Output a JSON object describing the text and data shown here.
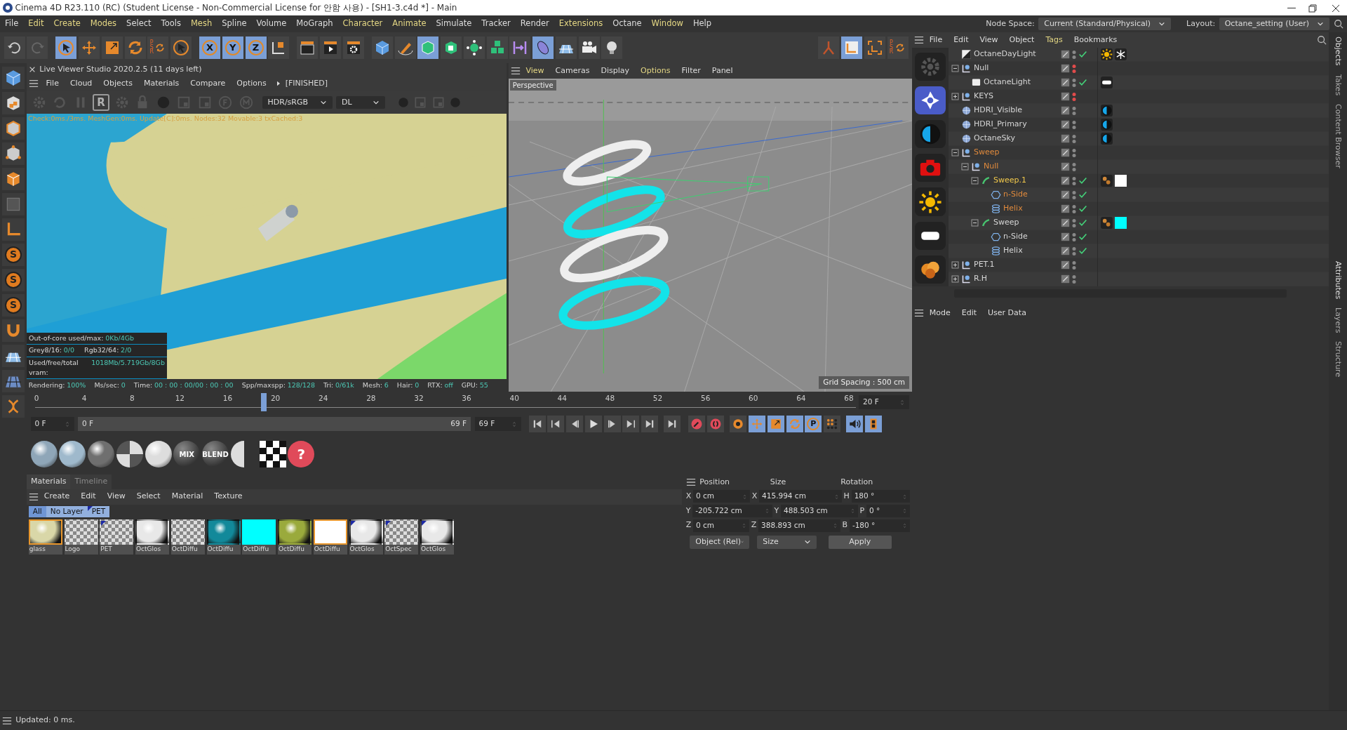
{
  "window": {
    "title": "Cinema 4D R23.110 (RC) (Student License - Non-Commercial License for 안함 사용) - [SH1-3.c4d *] - Main"
  },
  "menu_bar": [
    {
      "label": "File",
      "accent": false
    },
    {
      "label": "Edit",
      "accent": true
    },
    {
      "label": "Create",
      "accent": true
    },
    {
      "label": "Modes",
      "accent": true
    },
    {
      "label": "Select",
      "accent": false
    },
    {
      "label": "Tools",
      "accent": false
    },
    {
      "label": "Mesh",
      "accent": true
    },
    {
      "label": "Spline",
      "accent": false
    },
    {
      "label": "Volume",
      "accent": false
    },
    {
      "label": "MoGraph",
      "accent": false
    },
    {
      "label": "Character",
      "accent": true
    },
    {
      "label": "Animate",
      "accent": true
    },
    {
      "label": "Simulate",
      "accent": false
    },
    {
      "label": "Tracker",
      "accent": false
    },
    {
      "label": "Render",
      "accent": false
    },
    {
      "label": "Extensions",
      "accent": true
    },
    {
      "label": "Octane",
      "accent": false
    },
    {
      "label": "Window",
      "accent": true
    },
    {
      "label": "Help",
      "accent": false
    }
  ],
  "node_space": {
    "label": "Node Space:",
    "value": "Current (Standard/Physical)"
  },
  "layout": {
    "label": "Layout:",
    "value": "Octane_setting (User)"
  },
  "main_toolbar": [
    {
      "kind": "undo",
      "selected": false
    },
    {
      "kind": "redo",
      "selected": false
    },
    {
      "kind": "cursor",
      "selected": true
    },
    {
      "kind": "move",
      "selected": false
    },
    {
      "kind": "scale",
      "selected": false
    },
    {
      "kind": "rotate",
      "selected": false
    },
    {
      "kind": "psr",
      "label": "PSR",
      "selected": false
    },
    {
      "kind": "cursor",
      "selected": false
    },
    {
      "kind": "axis",
      "label": "X",
      "selected": true
    },
    {
      "kind": "axis",
      "label": "Y",
      "selected": true
    },
    {
      "kind": "axis",
      "label": "Z",
      "selected": true
    },
    {
      "kind": "coord",
      "selected": false
    },
    {
      "kind": "clapper",
      "selected": false
    },
    {
      "kind": "clapper-play",
      "selected": false
    },
    {
      "kind": "clapper-gear",
      "selected": false
    },
    {
      "kind": "cube",
      "selected": false
    },
    {
      "kind": "pen",
      "selected": false
    },
    {
      "kind": "cube-outline",
      "selected": true
    },
    {
      "kind": "cube-frame",
      "selected": false
    },
    {
      "kind": "node-sphere",
      "selected": false
    },
    {
      "kind": "cubes",
      "selected": false
    },
    {
      "kind": "bracket",
      "selected": false
    },
    {
      "kind": "disc",
      "selected": true
    },
    {
      "kind": "floor",
      "selected": false
    },
    {
      "kind": "camera",
      "selected": false
    },
    {
      "kind": "bulb",
      "selected": false
    }
  ],
  "snap_toolbar": [
    {
      "kind": "joint",
      "selected": false
    },
    {
      "kind": "frame",
      "selected": true
    },
    {
      "kind": "corner",
      "selected": false
    },
    {
      "kind": "psr",
      "label": "PSR",
      "selected": false
    }
  ],
  "left_tools": [
    {
      "kind": "cube"
    },
    {
      "kind": "checker-cube"
    },
    {
      "kind": "edge-cube"
    },
    {
      "kind": "point-cube"
    },
    {
      "kind": "solid-cube"
    },
    {
      "kind": "dark-cube"
    },
    {
      "kind": "l-angle"
    },
    {
      "kind": "s-circle",
      "label": "S"
    },
    {
      "kind": "s-circle",
      "label": "S"
    },
    {
      "kind": "s-circle",
      "label": "S"
    },
    {
      "kind": "magnet"
    },
    {
      "kind": "floor"
    },
    {
      "kind": "plane-grid"
    },
    {
      "kind": "twist"
    }
  ],
  "live_viewer": {
    "title": "Live Viewer Studio 2020.2.5 (11 days left)",
    "menu": [
      "File",
      "Cloud",
      "Objects",
      "Materials",
      "Compare",
      "Options"
    ],
    "status": "[FINISHED]",
    "toolbar": [
      {
        "kind": "gear"
      },
      {
        "kind": "refresh"
      },
      {
        "kind": "pause"
      },
      {
        "kind": "letter",
        "label": "R"
      },
      {
        "kind": "gear"
      },
      {
        "kind": "lock"
      },
      {
        "kind": "ball"
      },
      {
        "kind": "region"
      },
      {
        "kind": "region"
      },
      {
        "kind": "f-circle"
      },
      {
        "kind": "m-circle"
      }
    ],
    "color_mode": "HDR/sRGB",
    "kernel": "DL",
    "info": "Check:0ms./3ms. MeshGen:0ms. Update[C]:0ms. Nodes:32 Movable:3 txCached:3",
    "overlay_rows": [
      [
        {
          "label": "Out-of-core used/max:",
          "value": "0Kb/4Gb"
        }
      ],
      [
        {
          "label": "Grey8/16:",
          "value": "0/0"
        },
        {
          "label": "Rgb32/64:",
          "value": "2/0"
        }
      ],
      [
        {
          "label": "Used/free/total vram:",
          "value": "1018Mb/5.719Gb/8Gb"
        }
      ]
    ],
    "stats": [
      {
        "label": "Rendering:",
        "value": "100%"
      },
      {
        "label": "Ms/sec:",
        "value": "0"
      },
      {
        "label": "Time:",
        "value": "00 : 00 : 00/00 : 00 : 00"
      },
      {
        "label": "Spp/maxspp:",
        "value": "128/128"
      },
      {
        "label": "Tri:",
        "value": "0/61k"
      },
      {
        "label": "Mesh:",
        "value": "6"
      },
      {
        "label": "Hair:",
        "value": "0"
      },
      {
        "label": "RTX:",
        "value": "off"
      },
      {
        "label": "GPU:",
        "value": "55"
      }
    ]
  },
  "viewport": {
    "menu": [
      {
        "label": "View",
        "accent": true
      },
      {
        "label": "Cameras",
        "accent": false
      },
      {
        "label": "Display",
        "accent": false
      },
      {
        "label": "Options",
        "accent": true
      },
      {
        "label": "Filter",
        "accent": false
      },
      {
        "label": "Panel",
        "accent": false
      }
    ],
    "camera": "Perspective",
    "grid_spacing": "Grid Spacing : 500 cm"
  },
  "octane_tools": [
    {
      "kind": "gear",
      "selected": false
    },
    {
      "kind": "aperture",
      "selected": true
    },
    {
      "kind": "half-circle",
      "selected": false
    },
    {
      "kind": "camera-red",
      "selected": false
    },
    {
      "kind": "sun",
      "selected": false
    },
    {
      "kind": "light-rect",
      "selected": false
    },
    {
      "kind": "explosion",
      "selected": false
    }
  ],
  "object_manager": {
    "menu": [
      {
        "label": "File",
        "accent": false
      },
      {
        "label": "Edit",
        "accent": false
      },
      {
        "label": "View",
        "accent": false
      },
      {
        "label": "Object",
        "accent": false
      },
      {
        "label": "Tags",
        "accent": true
      },
      {
        "label": "Bookmarks",
        "accent": false
      }
    ],
    "objects": [
      {
        "name": "OctaneDayLight",
        "kind": "daylight",
        "selected": false,
        "active": false,
        "visibility_off": false,
        "enabled": true,
        "tags": [
          {
            "kind": "sun"
          },
          {
            "kind": "snowflake"
          }
        ]
      },
      {
        "name": "Null",
        "kind": "null",
        "selected": false,
        "active": false,
        "visibility_off": true,
        "enabled": false,
        "expanded": true,
        "children": [
          {
            "name": "OctaneLight",
            "kind": "light",
            "selected": false,
            "active": false,
            "visibility_off": false,
            "enabled": true,
            "tags": [
              {
                "kind": "light-rect"
              }
            ]
          }
        ]
      },
      {
        "name": "KEYS",
        "kind": "null",
        "selected": false,
        "active": false,
        "visibility_off": true,
        "enabled": false,
        "expanded": false
      },
      {
        "name": "HDRI_Visible",
        "kind": "sky",
        "selected": false,
        "active": false,
        "visibility_off": false,
        "enabled": false,
        "tags": [
          {
            "kind": "half-circle"
          }
        ]
      },
      {
        "name": "HDRI_Primary",
        "kind": "sky",
        "selected": false,
        "active": false,
        "visibility_off": false,
        "enabled": false,
        "tags": [
          {
            "kind": "half-circle"
          }
        ]
      },
      {
        "name": "OctaneSky",
        "kind": "sky",
        "selected": false,
        "active": false,
        "visibility_off": false,
        "enabled": false,
        "tags": [
          {
            "kind": "half-circle"
          }
        ]
      },
      {
        "name": "Sweep",
        "kind": "null",
        "selected": true,
        "active": false,
        "visibility_off": false,
        "enabled": false,
        "expanded": true,
        "children": [
          {
            "name": "Null",
            "kind": "null",
            "selected": true,
            "active": false,
            "visibility_off": false,
            "enabled": false,
            "expanded": true,
            "children": [
              {
                "name": "Sweep.1",
                "kind": "sweep",
                "selected": true,
                "active": true,
                "visibility_off": false,
                "enabled": true,
                "expanded": true,
                "tags": [
                  {
                    "kind": "phong"
                  },
                  {
                    "kind": "material",
                    "color": "#ffffff"
                  }
                ],
                "children": [
                  {
                    "name": "n-Side",
                    "kind": "nside",
                    "selected": true,
                    "active": false,
                    "visibility_off": false,
                    "enabled": true
                  },
                  {
                    "name": "Helix",
                    "kind": "helix",
                    "selected": true,
                    "active": false,
                    "visibility_off": false,
                    "enabled": true
                  }
                ]
              },
              {
                "name": "Sweep",
                "kind": "sweep",
                "selected": false,
                "active": false,
                "visibility_off": false,
                "enabled": true,
                "expanded": true,
                "tags": [
                  {
                    "kind": "phong"
                  },
                  {
                    "kind": "material",
                    "color": "#00ffff"
                  }
                ],
                "children": [
                  {
                    "name": "n-Side",
                    "kind": "nside",
                    "selected": false,
                    "active": false,
                    "visibility_off": false,
                    "enabled": true
                  },
                  {
                    "name": "Helix",
                    "kind": "helix",
                    "selected": false,
                    "active": false,
                    "visibility_off": false,
                    "enabled": true
                  }
                ]
              }
            ]
          }
        ]
      },
      {
        "name": "PET.1",
        "kind": "null",
        "selected": false,
        "active": false,
        "visibility_off": false,
        "enabled": false,
        "expanded": false
      },
      {
        "name": "R.H",
        "kind": "null",
        "selected": false,
        "active": false,
        "visibility_off": false,
        "enabled": false,
        "expanded": false
      }
    ]
  },
  "side_tabs_top": [
    "Objects",
    "Takes",
    "Content Browser"
  ],
  "attributes": {
    "menu": [
      "Mode",
      "Edit",
      "User Data"
    ]
  },
  "side_tabs_bottom": [
    "Attributes",
    "Layers",
    "Structure"
  ],
  "timeline": {
    "ticks": [
      "0",
      "4",
      "8",
      "12",
      "16",
      "20",
      "24",
      "28",
      "32",
      "36",
      "40",
      "44",
      "48",
      "52",
      "56",
      "60",
      "64",
      "68"
    ],
    "level": 0.28,
    "current_frame": "20 F",
    "start": "0 F",
    "range_start": "0 F",
    "range_end": "69 F",
    "end": "69 F",
    "transport": [
      {
        "kind": "first"
      },
      {
        "kind": "prev-key"
      },
      {
        "kind": "prev-frame"
      },
      {
        "kind": "play"
      },
      {
        "kind": "next-frame"
      },
      {
        "kind": "next-key"
      },
      {
        "kind": "last-frame"
      },
      {
        "kind": "goto-end"
      }
    ],
    "keys": [
      {
        "kind": "record"
      },
      {
        "kind": "autokey"
      },
      {
        "kind": "key-gear"
      },
      {
        "kind": "move"
      },
      {
        "kind": "scale"
      },
      {
        "kind": "rotate"
      },
      {
        "kind": "letter",
        "label": "P"
      },
      {
        "kind": "dots"
      },
      {
        "kind": "speaker"
      },
      {
        "kind": "film"
      }
    ]
  },
  "material_presets": [
    {
      "kind": "sphere",
      "color": "#8fa6b8"
    },
    {
      "kind": "sphere",
      "color": "#9fb9cc"
    },
    {
      "kind": "sphere",
      "color": "#6f6f6f"
    },
    {
      "kind": "quad"
    },
    {
      "kind": "sphere",
      "color": "#dddddd"
    },
    {
      "kind": "label",
      "label": "MIX"
    },
    {
      "kind": "label",
      "label": "BLEND"
    },
    {
      "kind": "split"
    },
    {
      "kind": "checker"
    },
    {
      "kind": "help",
      "label": "?"
    }
  ],
  "materials": {
    "tabs": [
      {
        "label": "Materials",
        "selected": true
      },
      {
        "label": "Timeline",
        "selected": false
      }
    ],
    "menu": [
      "Create",
      "Edit",
      "View",
      "Select",
      "Material",
      "Texture"
    ],
    "layers": [
      {
        "label": "All",
        "selected": true,
        "flag": false
      },
      {
        "label": "No Layer",
        "selected": false,
        "flag": false
      },
      {
        "label": "PET",
        "selected": false,
        "flag": true
      }
    ],
    "items": [
      {
        "name": "glass",
        "kind": "sphere",
        "color": "#d9d7a8",
        "selected": true,
        "flag": false
      },
      {
        "name": "Logo",
        "kind": "checker",
        "selected": false,
        "flag": false
      },
      {
        "name": "PET",
        "kind": "checker",
        "selected": false,
        "flag": true
      },
      {
        "name": "OctGlos",
        "kind": "sphere",
        "color": "#e8e8e8",
        "selected": false,
        "flag": false
      },
      {
        "name": "OctDiffu",
        "kind": "checker",
        "selected": false,
        "flag": false
      },
      {
        "name": "OctDiffu",
        "kind": "sphere",
        "color": "#12899a",
        "selected": false,
        "flag": false
      },
      {
        "name": "OctDiffu",
        "kind": "flat",
        "color": "#00ffff",
        "selected": false,
        "flag": false
      },
      {
        "name": "OctDiffu",
        "kind": "sphere",
        "color": "#9aaa3c",
        "selected": false,
        "flag": false
      },
      {
        "name": "OctDiffu",
        "kind": "flat",
        "color": "#ffffff",
        "selected": true,
        "flag": false
      },
      {
        "name": "OctGlos",
        "kind": "sphere",
        "color": "#e8e8e8",
        "selected": false,
        "flag": true
      },
      {
        "name": "OctSpec",
        "kind": "checker",
        "selected": false,
        "flag": true
      },
      {
        "name": "OctGlos",
        "kind": "sphere",
        "color": "#e8e8e8",
        "selected": false,
        "flag": true
      }
    ]
  },
  "coordinates": {
    "headers": [
      "Position",
      "Size",
      "Rotation"
    ],
    "rows": [
      [
        {
          "axis": "X",
          "value": "0 cm"
        },
        {
          "axis": "X",
          "value": "415.994 cm"
        },
        {
          "axis": "H",
          "value": "180 °"
        }
      ],
      [
        {
          "axis": "Y",
          "value": "-205.722 cm"
        },
        {
          "axis": "Y",
          "value": "488.503 cm"
        },
        {
          "axis": "P",
          "value": "0 °"
        }
      ],
      [
        {
          "axis": "Z",
          "value": "0 cm"
        },
        {
          "axis": "Z",
          "value": "388.893 cm"
        },
        {
          "axis": "B",
          "value": "-180 °"
        }
      ]
    ],
    "space": "Object (Rel)",
    "mode": "Size",
    "apply": "Apply"
  },
  "status_bar": "Updated: 0 ms."
}
